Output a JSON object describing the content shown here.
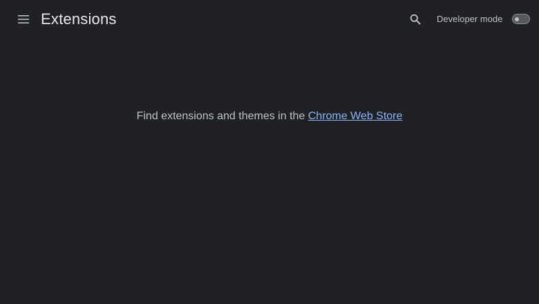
{
  "header": {
    "title": "Extensions",
    "menu_icon": "hamburger-menu-icon",
    "search_icon": "search-icon",
    "developer_mode_label": "Developer mode",
    "developer_mode_enabled": false
  },
  "main": {
    "empty_text": "Find extensions and themes in the ",
    "store_link_label": "Chrome Web Store"
  },
  "colors": {
    "background": "#202124",
    "title_text": "#e8eaed",
    "secondary_text": "#bdc1c6",
    "link": "#8ab4f8"
  }
}
